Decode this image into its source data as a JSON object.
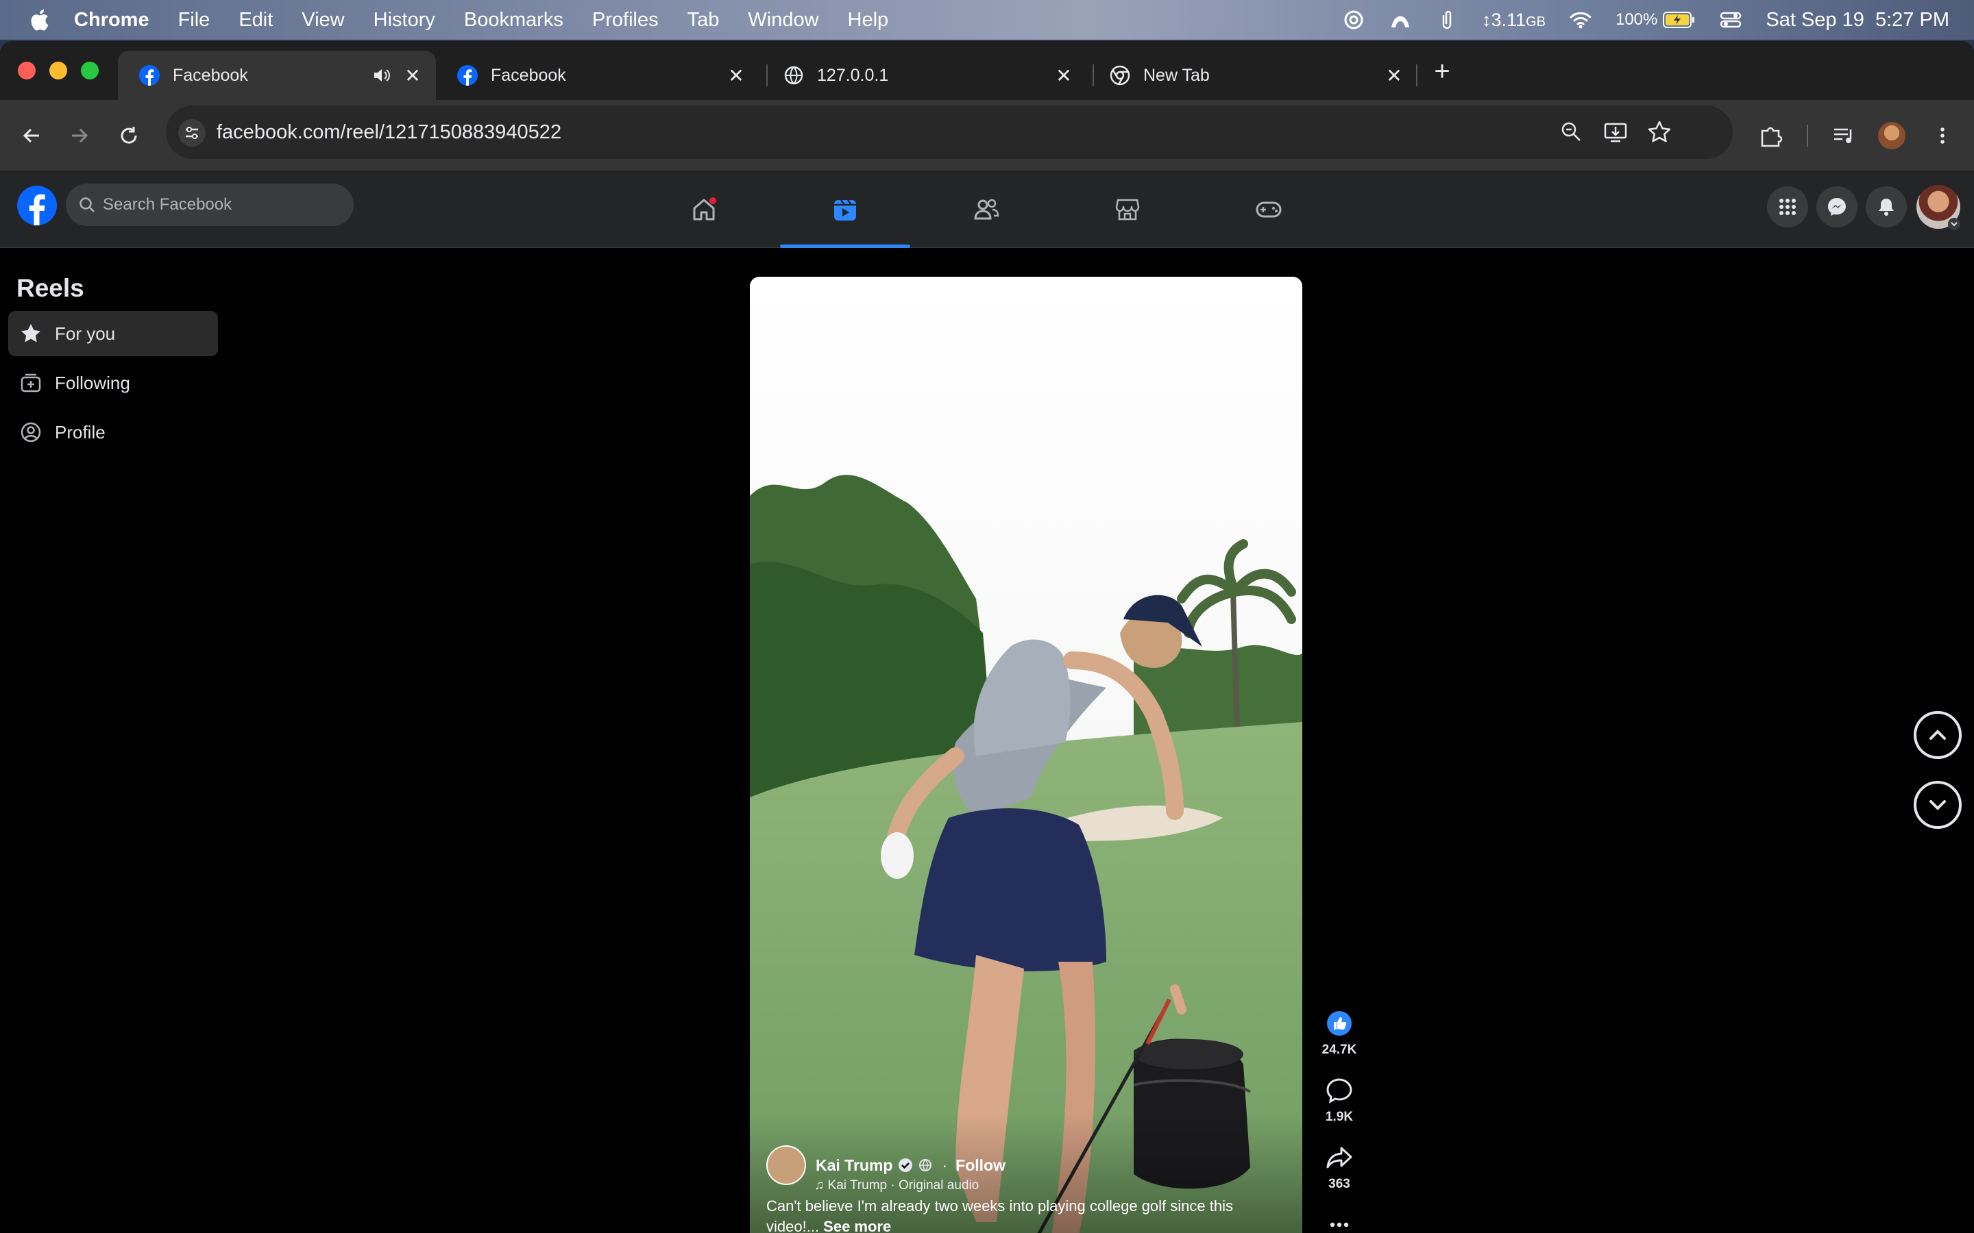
{
  "menubar": {
    "app": "Chrome",
    "items": [
      "File",
      "Edit",
      "View",
      "History",
      "Bookmarks",
      "Profiles",
      "Tab",
      "Window",
      "Help"
    ],
    "memory": "3.11",
    "memory_unit": "GB",
    "battery": "100%",
    "datetime": "Sat Sep 19  5:27 PM"
  },
  "tabs": [
    {
      "title": "Facebook",
      "active": true,
      "audio": true
    },
    {
      "title": "Facebook",
      "active": false
    },
    {
      "title": "127.0.0.1",
      "active": false
    },
    {
      "title": "New Tab",
      "active": false
    }
  ],
  "omnibox": {
    "url": "facebook.com/reel/1217150883940522"
  },
  "facebook": {
    "search_placeholder": "Search Facebook",
    "sidebar_title": "Reels",
    "sidebar_items": [
      {
        "label": "For you",
        "active": true
      },
      {
        "label": "Following",
        "active": false
      },
      {
        "label": "Profile",
        "active": false
      }
    ],
    "reel": {
      "author": "Kai Trump",
      "follow_label": "Follow",
      "audio": "Kai Trump · Original audio",
      "caption": "Can't believe I'm already two weeks into playing college golf since this video!...",
      "see_more": "See more",
      "likes": "24.7K",
      "comments": "1.9K",
      "shares": "363"
    }
  },
  "colors": {
    "accent": "#2d88ff",
    "fb_blue": "#0866ff"
  }
}
